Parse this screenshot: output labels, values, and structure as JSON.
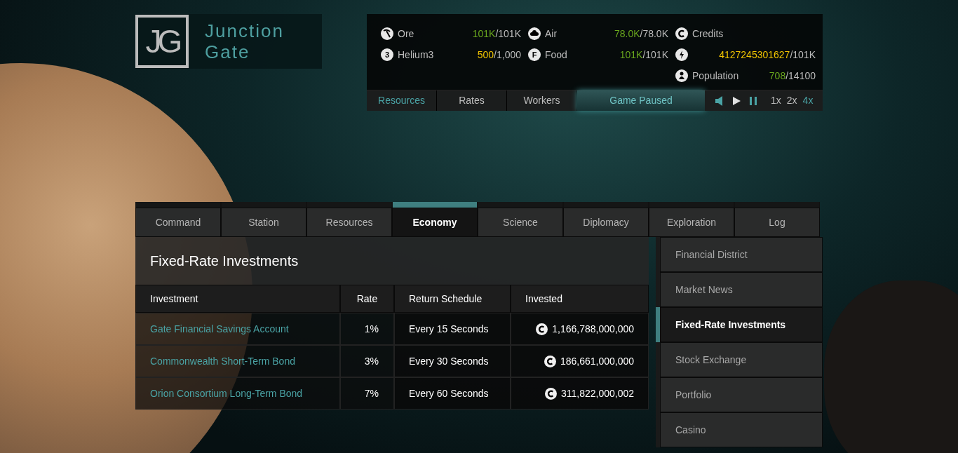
{
  "logo": {
    "mark": "JG",
    "title_line_1": "Junction",
    "title_line_2": "Gate"
  },
  "resources": [
    {
      "name": "Ore",
      "kind": "pickaxe",
      "current": "101K",
      "max": "/101K",
      "color": "#6aa81e"
    },
    {
      "name": "Air",
      "kind": "cloud",
      "current": "78.0K",
      "max": "/78.0K",
      "color": "#6aa81e"
    },
    {
      "name": "Credits",
      "kind": "credit"
    },
    {
      "name": "Helium3",
      "kind": "letter",
      "glyph": "3",
      "current": "500",
      "max": "/1,000",
      "color": "#f0c400"
    },
    {
      "name": "Food",
      "kind": "letter",
      "glyph": "F",
      "current": "101K",
      "max": "/101K",
      "color": "#6aa81e"
    },
    {
      "kind": "bolt",
      "current": "4127245301627",
      "max": "/101K",
      "color": "#f0c400"
    },
    {
      "kind": "blank"
    },
    {
      "kind": "blank"
    },
    {
      "name": "Population",
      "kind": "person",
      "current": "708",
      "max": "/14100",
      "color": "#6aa81e"
    }
  ],
  "resource_tabs": [
    {
      "label": "Resources",
      "selected": true
    },
    {
      "label": "Rates",
      "selected": false
    },
    {
      "label": "Workers",
      "selected": false
    }
  ],
  "status": "Game Paused",
  "controls": {
    "sound_on": true,
    "paused": true,
    "speeds": [
      {
        "label": "1x",
        "selected": false
      },
      {
        "label": "2x",
        "selected": false
      },
      {
        "label": "4x",
        "selected": true
      }
    ]
  },
  "main_tabs": [
    {
      "label": "Command",
      "selected": false
    },
    {
      "label": "Station",
      "selected": false
    },
    {
      "label": "Resources",
      "selected": false
    },
    {
      "label": "Economy",
      "selected": true
    },
    {
      "label": "Science",
      "selected": false
    },
    {
      "label": "Diplomacy",
      "selected": false
    },
    {
      "label": "Exploration",
      "selected": false
    },
    {
      "label": "Log",
      "selected": false
    }
  ],
  "section_title": "Fixed-Rate Investments",
  "table": {
    "columns": [
      "Investment",
      "Rate",
      "Return Schedule",
      "Invested"
    ],
    "rows": [
      {
        "investment": "Gate Financial Savings Account",
        "rate": "1%",
        "schedule": "Every 15 Seconds",
        "invested": "1,166,788,000,000"
      },
      {
        "investment": "Commonwealth Short-Term Bond",
        "rate": "3%",
        "schedule": "Every 30 Seconds",
        "invested": "186,661,000,000"
      },
      {
        "investment": "Orion Consortium Long-Term Bond",
        "rate": "7%",
        "schedule": "Every 60 Seconds",
        "invested": "311,822,000,002"
      }
    ]
  },
  "sidebar": {
    "items": [
      {
        "label": "Financial District",
        "selected": false
      },
      {
        "label": "Market News",
        "selected": false
      },
      {
        "label": "Fixed-Rate Investments",
        "selected": true
      },
      {
        "label": "Stock Exchange",
        "selected": false
      },
      {
        "label": "Portfolio",
        "selected": false
      },
      {
        "label": "Casino",
        "selected": false
      }
    ]
  }
}
